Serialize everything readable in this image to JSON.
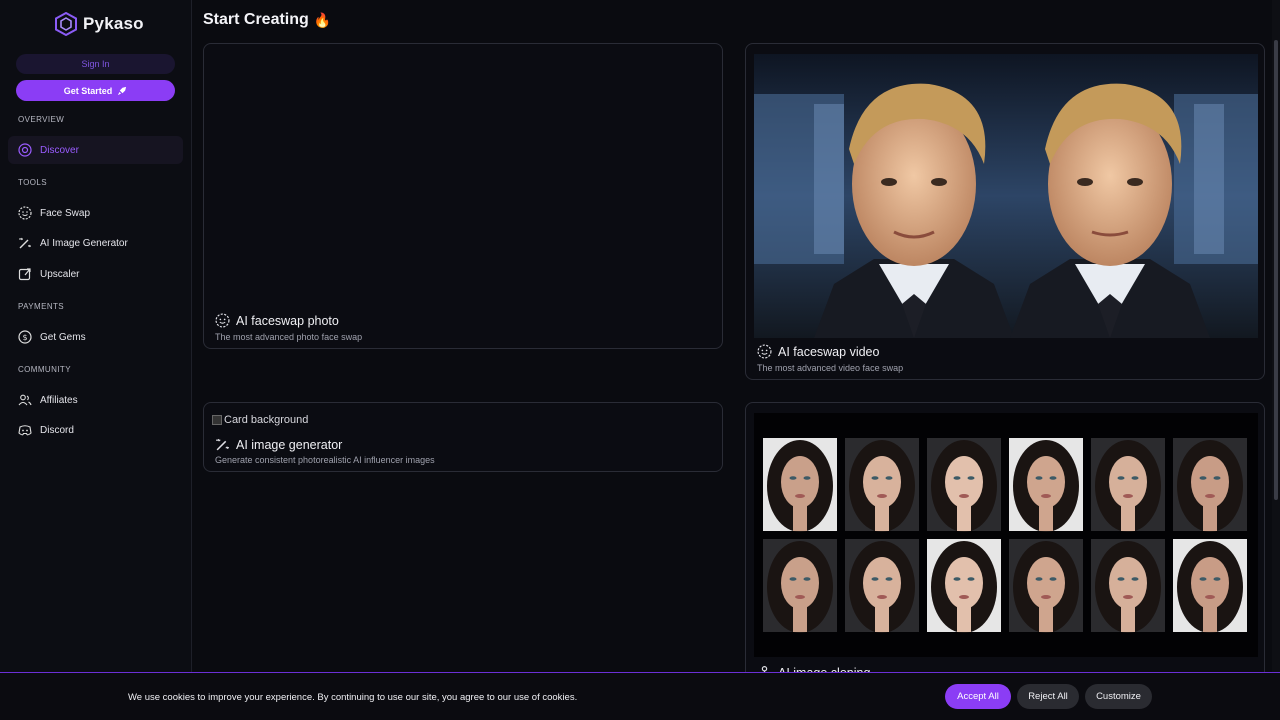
{
  "brand": {
    "name": "Pykaso",
    "accent": "#8b3df5"
  },
  "sidebar": {
    "sign_in": "Sign In",
    "get_started": "Get Started",
    "sections": {
      "overview": "OVERVIEW",
      "tools": "TOOLS",
      "payments": "PAYMENTS",
      "community": "COMMUNITY"
    },
    "items": {
      "discover": "Discover",
      "face_swap": "Face Swap",
      "ai_image_generator": "AI Image Generator",
      "upscaler": "Upscaler",
      "get_gems": "Get Gems",
      "affiliates": "Affiliates",
      "discord": "Discord"
    }
  },
  "main": {
    "title": "Start Creating",
    "title_emoji": "🔥",
    "cards": {
      "faceswap_photo": {
        "title": "AI faceswap photo",
        "subtitle": "The most advanced photo face swap"
      },
      "faceswap_video": {
        "title": "AI faceswap video",
        "subtitle": "The most advanced video face swap"
      },
      "image_generator": {
        "alt": "Card background",
        "title": "AI image generator",
        "subtitle": "Generate consistent photorealistic AI influencer images"
      },
      "image_cloning": {
        "title": "AI image cloning"
      }
    }
  },
  "cookie_banner": {
    "text": "We use cookies to improve your experience. By continuing to use our site, you agree to our use of cookies.",
    "accept": "Accept All",
    "reject": "Reject All",
    "customize": "Customize"
  }
}
